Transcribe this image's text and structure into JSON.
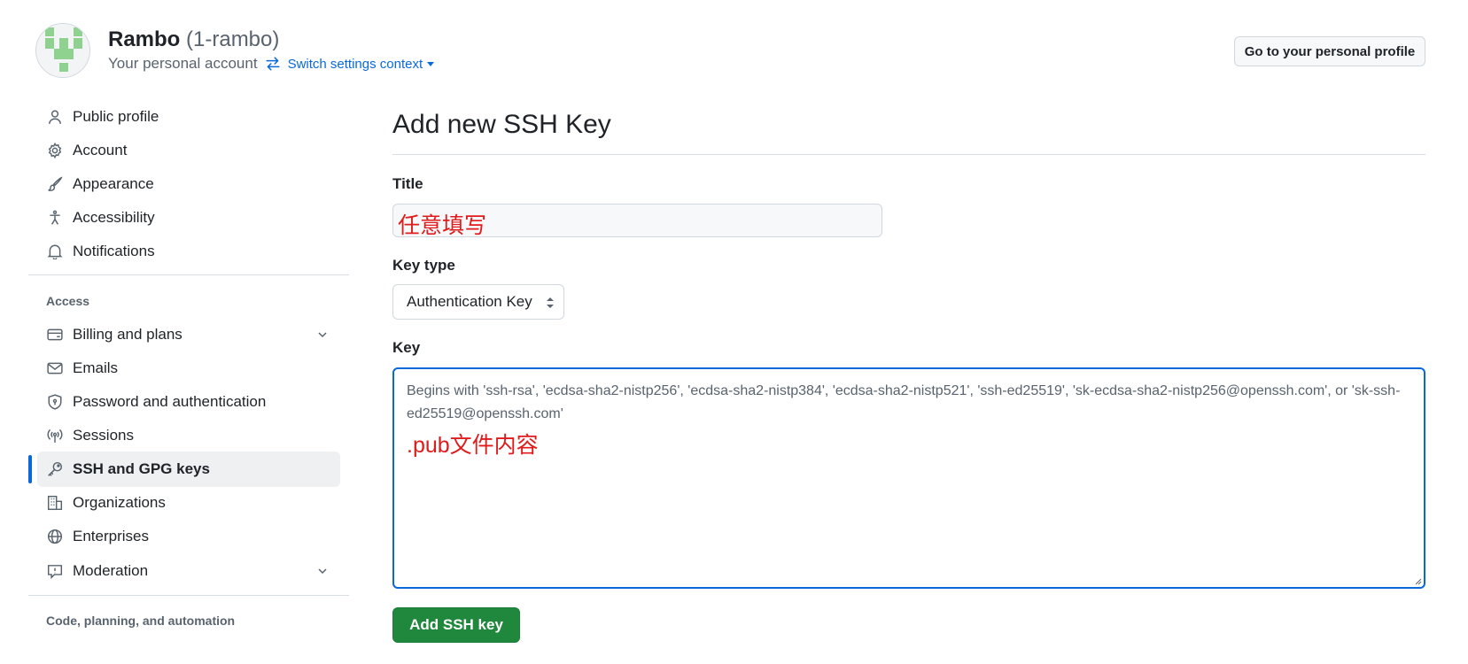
{
  "header": {
    "display_name": "Rambo",
    "username": "(1-rambo)",
    "account_subtitle": "Your personal account",
    "switch_context_label": "Switch settings context",
    "profile_button_label": "Go to your personal profile",
    "avatar_color": "#8fd18f"
  },
  "sidebar": {
    "top_items": [
      {
        "label": "Public profile",
        "icon": "person-icon"
      },
      {
        "label": "Account",
        "icon": "gear-icon"
      },
      {
        "label": "Appearance",
        "icon": "paintbrush-icon"
      },
      {
        "label": "Accessibility",
        "icon": "accessibility-icon"
      },
      {
        "label": "Notifications",
        "icon": "bell-icon"
      }
    ],
    "access_section_label": "Access",
    "access_items": [
      {
        "label": "Billing and plans",
        "icon": "credit-card-icon",
        "expandable": true
      },
      {
        "label": "Emails",
        "icon": "mail-icon"
      },
      {
        "label": "Password and authentication",
        "icon": "shield-lock-icon"
      },
      {
        "label": "Sessions",
        "icon": "broadcast-icon"
      },
      {
        "label": "SSH and GPG keys",
        "icon": "key-icon",
        "active": true
      },
      {
        "label": "Organizations",
        "icon": "organization-icon"
      },
      {
        "label": "Enterprises",
        "icon": "globe-icon"
      },
      {
        "label": "Moderation",
        "icon": "report-icon",
        "expandable": true
      }
    ],
    "code_section_label": "Code, planning, and automation"
  },
  "main": {
    "page_title": "Add new SSH Key",
    "title_label": "Title",
    "title_annotation": "任意填写",
    "key_type_label": "Key type",
    "key_type_value": "Authentication Key",
    "key_label": "Key",
    "key_placeholder": "Begins with 'ssh-rsa', 'ecdsa-sha2-nistp256', 'ecdsa-sha2-nistp384', 'ecdsa-sha2-nistp521', 'ssh-ed25519', 'sk-ecdsa-sha2-nistp256@openssh.com', or 'sk-ssh-ed25519@openssh.com'",
    "key_annotation": ".pub文件内容",
    "submit_label": "Add SSH key"
  },
  "colors": {
    "accent": "#0969da",
    "primary_button": "#1f883d",
    "annotation": "#e01b1b"
  }
}
